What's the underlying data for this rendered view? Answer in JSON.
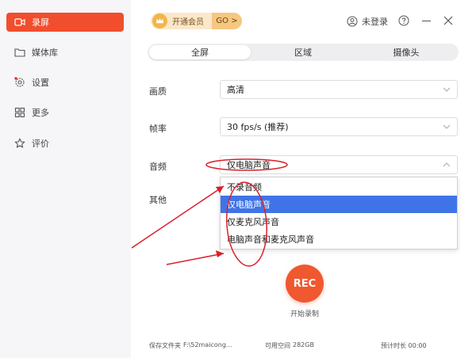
{
  "sidebar": {
    "items": [
      {
        "label": "录屏",
        "icon": "video-icon"
      },
      {
        "label": "媒体库",
        "icon": "folder-icon"
      },
      {
        "label": "设置",
        "icon": "gear-icon"
      },
      {
        "label": "更多",
        "icon": "grid-icon"
      },
      {
        "label": "评价",
        "icon": "star-icon"
      }
    ]
  },
  "header": {
    "vip_label": "开通会员",
    "vip_go": "GO >",
    "login_label": "未登录"
  },
  "tabs": [
    {
      "label": "全屏",
      "active": true
    },
    {
      "label": "区域",
      "active": false
    },
    {
      "label": "摄像头",
      "active": false
    }
  ],
  "settings": {
    "quality": {
      "label": "画质",
      "value": "高清"
    },
    "framerate": {
      "label": "帧率",
      "value": "30 fps/s (推荐)"
    },
    "audio": {
      "label": "音频",
      "value": "仅电脑声音"
    },
    "other": {
      "label": "其他"
    }
  },
  "audio_options": [
    {
      "label": "不录音频",
      "selected": false
    },
    {
      "label": "仅电脑声音",
      "selected": true
    },
    {
      "label": "仅麦克风声音",
      "selected": false
    },
    {
      "label": "电脑声音和麦克风声音",
      "selected": false
    }
  ],
  "record": {
    "button": "REC",
    "label": "开始录制"
  },
  "footer": {
    "save_folder_label": "保存文件夹",
    "save_folder_value": "F:\\52maicong...",
    "free_space_label": "可用空间",
    "free_space_value": "282GB",
    "shortcut_hint": "预计时长 00:00"
  },
  "colors": {
    "accent": "#f04e2d",
    "selection": "#3f74e8",
    "annotation": "#d9202a"
  }
}
